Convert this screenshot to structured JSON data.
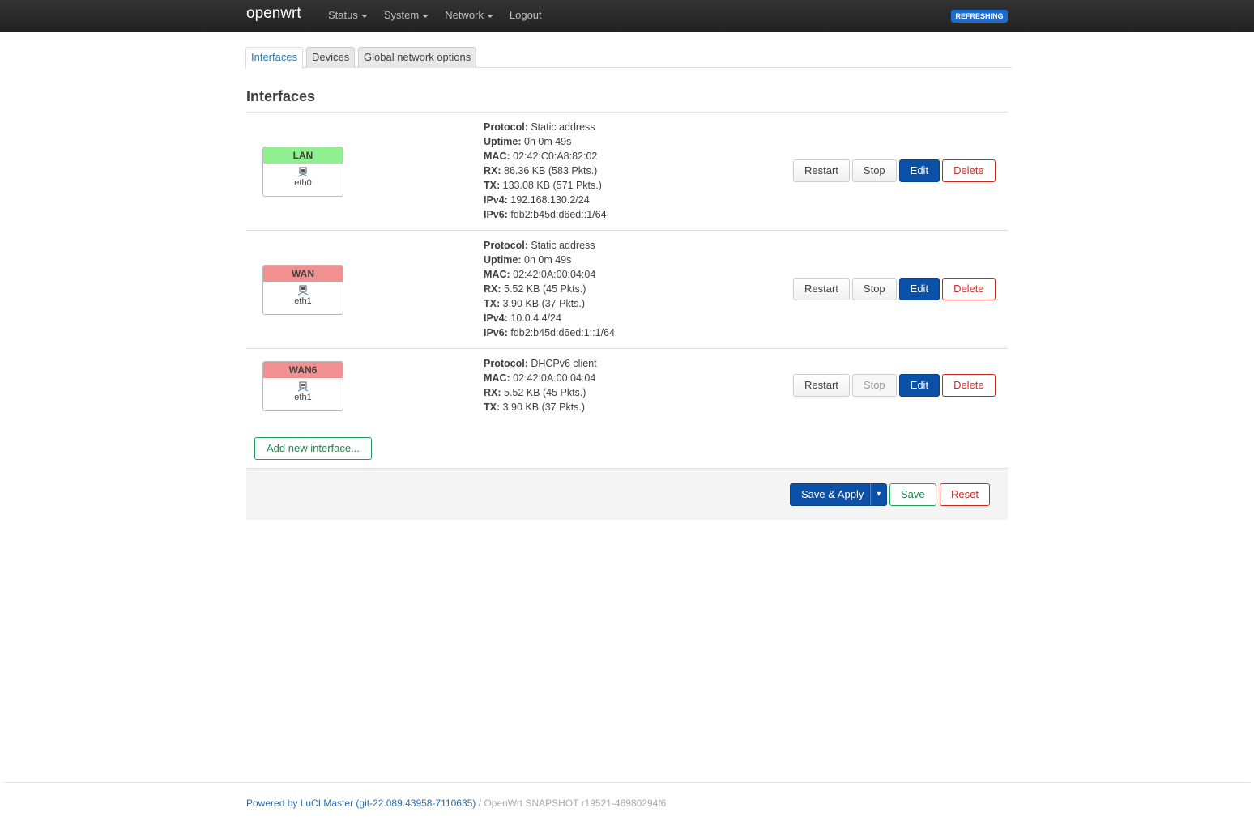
{
  "navbar": {
    "brand": "openwrt",
    "menu": [
      "Status",
      "System",
      "Network",
      "Logout"
    ],
    "status_badge": "REFRESHING"
  },
  "tabs": [
    "Interfaces",
    "Devices",
    "Global network options"
  ],
  "page_title": "Interfaces",
  "interfaces": [
    {
      "name": "LAN",
      "device": "eth0",
      "color": "#90f090",
      "labels": [
        "Protocol:",
        "Uptime:",
        "MAC:",
        "RX:",
        "TX:",
        "IPv4:",
        "IPv6:"
      ],
      "values": [
        " Static address",
        " 0h 0m 49s",
        " 02:42:C0:A8:82:02",
        " 86.36 KB (583 Pkts.)",
        " 133.08 KB (571 Pkts.)",
        " 192.168.130.2/24",
        " fdb2:b45d:d6ed::1/64"
      ],
      "buttons": {
        "restart": "Restart",
        "stop": "Stop",
        "edit": "Edit",
        "delete": "Delete"
      }
    },
    {
      "name": "WAN",
      "device": "eth1",
      "color": "#f09090",
      "labels": [
        "Protocol:",
        "Uptime:",
        "MAC:",
        "RX:",
        "TX:",
        "IPv4:",
        "IPv6:"
      ],
      "values": [
        " Static address",
        " 0h 0m 49s",
        " 02:42:0A:00:04:04",
        " 5.52 KB (45 Pkts.)",
        " 3.90 KB (37 Pkts.)",
        " 10.0.4.4/24",
        " fdb2:b45d:d6ed:1::1/64"
      ],
      "buttons": {
        "restart": "Restart",
        "stop": "Stop",
        "edit": "Edit",
        "delete": "Delete"
      }
    },
    {
      "name": "WAN6",
      "device": "eth1",
      "color": "#f09090",
      "labels": [
        "Protocol:",
        "MAC:",
        "RX:",
        "TX:"
      ],
      "values": [
        " DHCPv6 client",
        " 02:42:0A:00:04:04",
        " 5.52 KB (45 Pkts.)",
        " 3.90 KB (37 Pkts.)"
      ],
      "buttons": {
        "restart": "Restart",
        "stop": "Stop",
        "edit": "Edit",
        "delete": "Delete"
      }
    }
  ],
  "add_interface_label": "Add new interface...",
  "actions": {
    "save_apply": "Save & Apply",
    "dropdown_glyph": "▾",
    "save": "Save",
    "reset": "Reset"
  },
  "footer": {
    "luci": "Powered by LuCI Master (git-22.089.43958-7110635)",
    "separator": " / ",
    "build": "OpenWrt SNAPSHOT r19521-46980294f6"
  }
}
